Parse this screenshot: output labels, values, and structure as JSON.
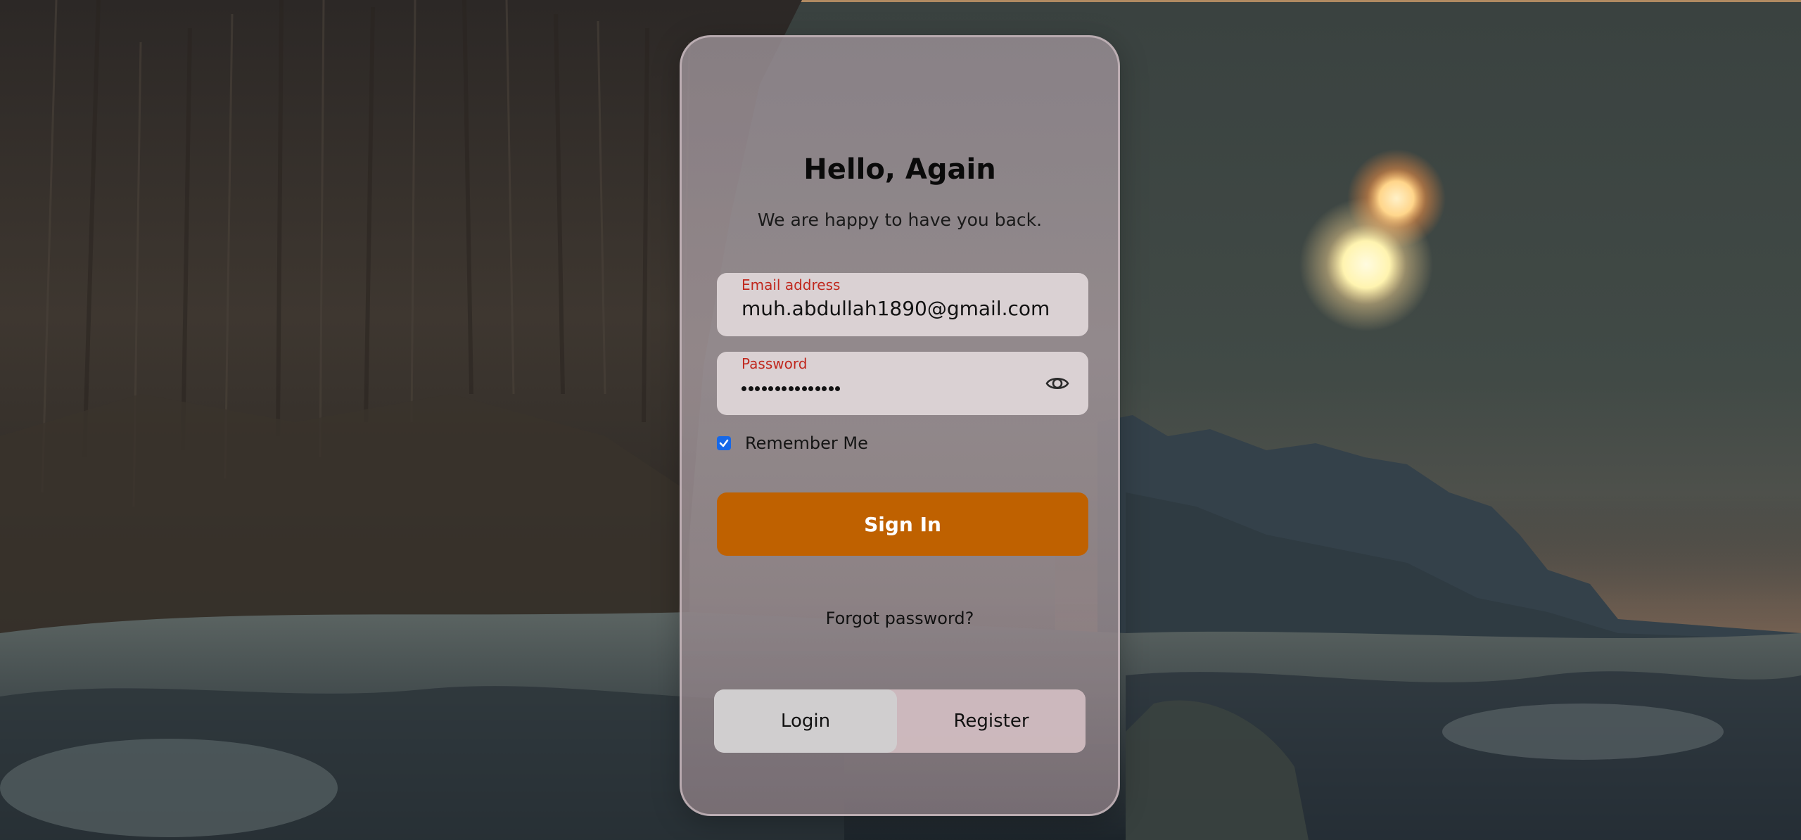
{
  "login": {
    "title": "Hello, Again",
    "subtitle": "We are happy to have you back.",
    "email": {
      "label": "Email address",
      "value": "muh.abdullah1890@gmail.com"
    },
    "password": {
      "label": "Password",
      "masked_length": 15,
      "toggle_icon": "eye-icon"
    },
    "remember": {
      "label": "Remember Me",
      "checked": true
    },
    "signin_label": "Sign In",
    "forgot_label": "Forgot password?",
    "tabs": [
      {
        "label": "Login",
        "active": true
      },
      {
        "label": "Register",
        "active": false
      }
    ]
  },
  "colors": {
    "accent": "#bf6100",
    "label_red": "#c0281e",
    "checkbox": "#1668e8"
  }
}
